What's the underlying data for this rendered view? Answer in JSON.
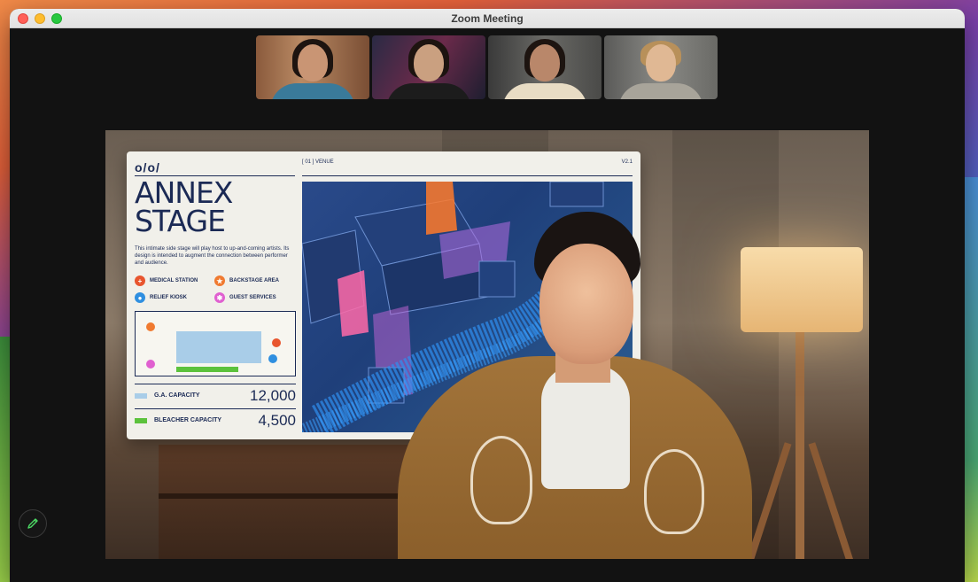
{
  "window": {
    "title": "Zoom Meeting"
  },
  "participants": [
    {
      "bg": "tile1",
      "skin": "#c99574",
      "shirt": "#3a7a9a"
    },
    {
      "bg": "tile2",
      "skin": "#caa080",
      "shirt": "#1c1c1c"
    },
    {
      "bg": "tile3",
      "skin": "#b9876a",
      "shirt": "#e8dcc4"
    },
    {
      "bg": "tile4",
      "skin": "#e0b894",
      "shirt": "#a8a49a",
      "hair": "#b8905a"
    }
  ],
  "slide": {
    "logo": "o/o/",
    "venue_label": "[ 01 ] VENUE",
    "version": "V2.1",
    "headline_line1": "ANNEX",
    "headline_line2": "STAGE",
    "description": "This intimate side stage will play host to up-and-coming artists. Its design is intended to augment the connection between performer and audience.",
    "legend": [
      {
        "label": "MEDICAL STATION",
        "color": "#e8552e",
        "glyph": "+"
      },
      {
        "label": "BACKSTAGE AREA",
        "color": "#f07a30",
        "glyph": "★"
      },
      {
        "label": "RELIEF KIOSK",
        "color": "#2f8fe0",
        "glyph": "●"
      },
      {
        "label": "GUEST SERVICES",
        "color": "#e060d0",
        "glyph": "✱"
      }
    ],
    "stats": [
      {
        "label": "G.A. CAPACITY",
        "value": "12,000",
        "swatch": "#a9cde8"
      },
      {
        "label": "BLEACHER CAPACITY",
        "value": "4,500",
        "swatch": "#5cc23c"
      }
    ]
  },
  "colors": {
    "slide_ink": "#1b2a55",
    "annotate_icon": "#4cd964"
  },
  "icons": {
    "annotate": "pencil-icon"
  }
}
